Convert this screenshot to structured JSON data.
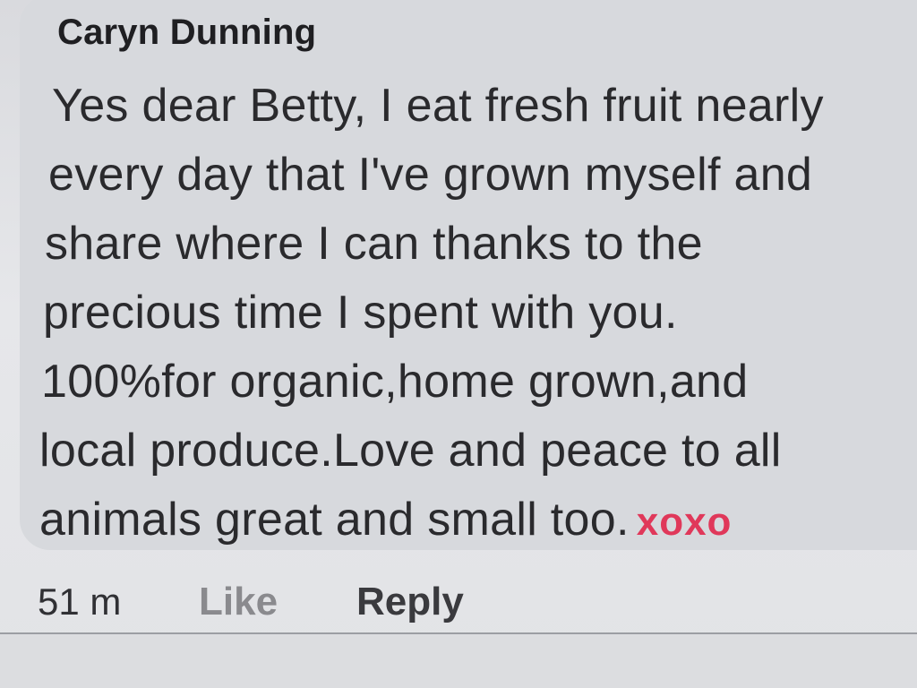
{
  "comment": {
    "author": "Caryn Dunning",
    "lines": [
      "Yes dear Betty, I eat fresh fruit nearly",
      "every day that I've grown myself and",
      "share where I can thanks to the",
      "precious time I spent with you.",
      "100%for organic,home grown,and",
      "local produce.Love and peace to all",
      "animals great and small too."
    ],
    "signoff": "xoxo",
    "signoff_color": "#e0385a"
  },
  "actions": {
    "time": "51 m",
    "like_label": "Like",
    "reply_label": "Reply"
  }
}
